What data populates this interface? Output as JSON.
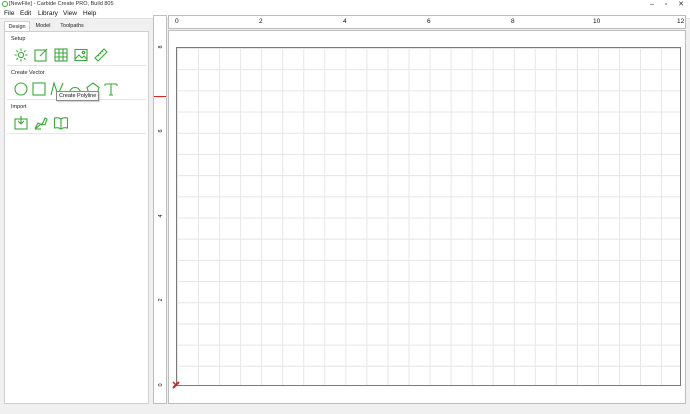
{
  "window": {
    "title": "[NewFile] - Carbide Create PRO, Build 805",
    "buttons": [
      "minimize",
      "maximize",
      "close"
    ]
  },
  "menu": [
    {
      "label": "File"
    },
    {
      "label": "Edit"
    },
    {
      "label": "Library"
    },
    {
      "label": "View"
    },
    {
      "label": "Help"
    }
  ],
  "tabs": [
    {
      "label": "Design"
    },
    {
      "label": "Model"
    },
    {
      "label": "Toolpaths"
    }
  ],
  "sections": {
    "setup": {
      "title": "Setup",
      "tools": [
        "job-setup-icon",
        "edit-icon",
        "grid-icon",
        "image-icon",
        "measure-icon"
      ]
    },
    "create_vector": {
      "title": "Create Vector",
      "tools": [
        "circle-icon",
        "rectangle-icon",
        "polyline-icon",
        "curve-icon",
        "polygon-icon",
        "text-icon"
      ]
    },
    "import": {
      "title": "Import",
      "tools": [
        "import-svg-icon",
        "import-dxf-icon",
        "vector-library-icon"
      ]
    }
  },
  "tooltip": "Create Polyline",
  "rulers": {
    "horizontal": [
      "0",
      "2",
      "4",
      "6",
      "8",
      "10",
      "12"
    ],
    "vertical": [
      "8",
      "6",
      "4",
      "2",
      "0"
    ]
  },
  "colors": {
    "tool_accent": "#3aa93a",
    "marker": "#d22222",
    "grid": "#e6e6e6"
  }
}
